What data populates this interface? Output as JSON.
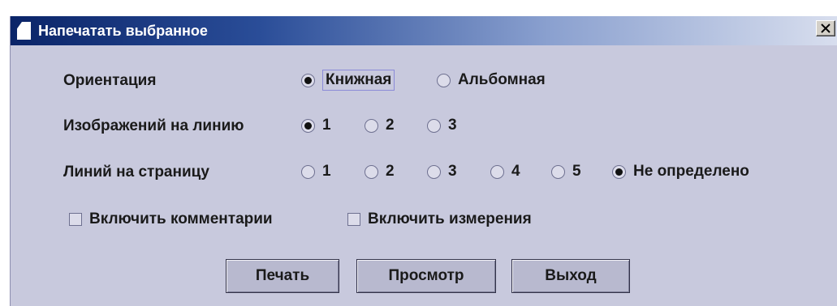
{
  "dialog": {
    "title": "Напечатать выбранное",
    "close_icon": "close-icon"
  },
  "orientation": {
    "label": "Ориентация",
    "options": [
      {
        "label": "Книжная",
        "checked": true
      },
      {
        "label": "Альбомная",
        "checked": false
      }
    ]
  },
  "images_per_line": {
    "label": "Изображений на линию",
    "options": [
      {
        "label": "1",
        "checked": true
      },
      {
        "label": "2",
        "checked": false
      },
      {
        "label": "3",
        "checked": false
      }
    ]
  },
  "lines_per_page": {
    "label": "Линий на страницу",
    "options": [
      {
        "label": "1",
        "checked": false
      },
      {
        "label": "2",
        "checked": false
      },
      {
        "label": "3",
        "checked": false
      },
      {
        "label": "4",
        "checked": false
      },
      {
        "label": "5",
        "checked": false
      },
      {
        "label": "Не определено",
        "checked": true
      }
    ]
  },
  "checkboxes": [
    {
      "label": "Включить комментарии",
      "checked": false
    },
    {
      "label": "Включить измерения",
      "checked": false
    }
  ],
  "buttons": {
    "print": "Печать",
    "preview": "Просмотр",
    "exit": "Выход"
  },
  "colors": {
    "dialog_background": "#c8c9dd",
    "titlebar_start": "#0a2468",
    "titlebar_end": "#d8deee"
  }
}
